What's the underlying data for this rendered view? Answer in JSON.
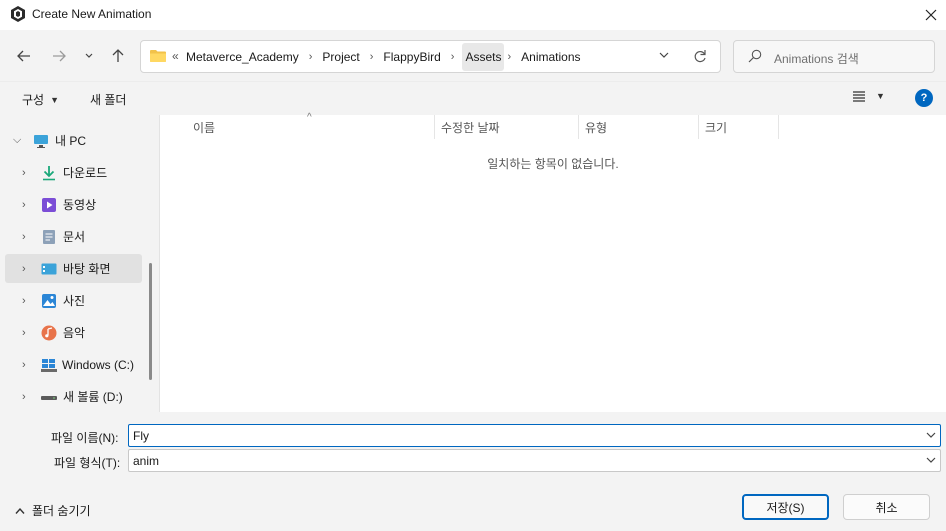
{
  "window": {
    "title": "Create New Animation",
    "app_icon": "unity-icon",
    "close_icon": "close-icon"
  },
  "nav": {
    "back_icon": "arrow-left-icon",
    "forward_icon": "arrow-right-icon",
    "recent_icon": "chevron-down-icon",
    "up_icon": "arrow-up-icon"
  },
  "address": {
    "folder_icon": "folder-icon",
    "overflow": "«",
    "crumbs": [
      "Metaverce_Academy",
      "Project",
      "FlappyBird",
      "Assets",
      "Animations"
    ],
    "refresh_icon": "refresh-icon"
  },
  "search": {
    "placeholder": "Animations 검색",
    "icon": "search-icon"
  },
  "toolbar": {
    "organize_label": "구성",
    "new_folder_label": "새 폴더",
    "view_icon": "list-view-icon",
    "help_label": "?"
  },
  "sidebar": {
    "items": [
      {
        "label": "내 PC",
        "icon": "pc-icon"
      },
      {
        "label": "다운로드",
        "icon": "download-icon"
      },
      {
        "label": "동영상",
        "icon": "video-icon"
      },
      {
        "label": "문서",
        "icon": "document-icon"
      },
      {
        "label": "바탕 화면",
        "icon": "desktop-icon"
      },
      {
        "label": "사진",
        "icon": "pictures-icon"
      },
      {
        "label": "음악",
        "icon": "music-icon"
      },
      {
        "label": "Windows (C:)",
        "icon": "windows-drive-icon"
      },
      {
        "label": "새 볼륨 (D:)",
        "icon": "drive-icon"
      }
    ],
    "selected": "바탕 화면"
  },
  "list": {
    "columns": [
      "이름",
      "수정한 날짜",
      "유형",
      "크기"
    ],
    "sort_indicator": "^",
    "empty_message": "일치하는 항목이 없습니다."
  },
  "form": {
    "filename_label": "파일 이름(N):",
    "filename_value": "Fly",
    "filetype_label": "파일 형식(T):",
    "filetype_value": "anim"
  },
  "footer": {
    "hide_folders_label": "폴더 숨기기",
    "save_label": "저장(S)",
    "cancel_label": "취소"
  },
  "colors": {
    "accent": "#0067c0",
    "chrome": "#f3f3f3"
  }
}
